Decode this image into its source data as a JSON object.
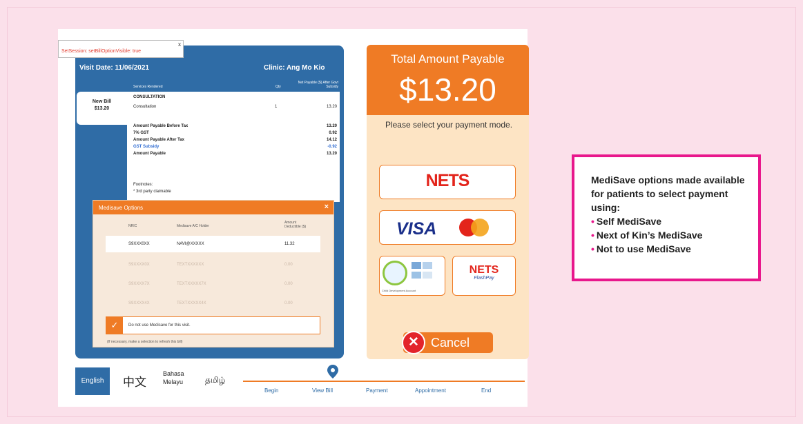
{
  "tooltip": {
    "text": "SetSession: setBillOptionVisible: true",
    "close": "x"
  },
  "bill": {
    "visit_date": "Visit Date: 11/06/2021",
    "clinic": "Clinic: Ang Mo Kio",
    "hdr_services": "Services Rendered",
    "hdr_qty": "Qty",
    "hdr_net": "Net Payable ($) After Govt Subsidy",
    "new_bill_label": "New Bill",
    "new_bill_amount": "$13.20",
    "lines": [
      {
        "label": "CONSULTATION",
        "qty": "",
        "amount": ""
      },
      {
        "label": "Consultation",
        "qty": "1",
        "amount": "13.20"
      },
      {
        "label": "Amount Payable Before Tax",
        "qty": "",
        "amount": "13.20"
      },
      {
        "label": "7% GST",
        "qty": "",
        "amount": "0.92"
      },
      {
        "label": "Amount Payable After Tax",
        "qty": "",
        "amount": "14.12"
      },
      {
        "label": "GST Subsidy",
        "qty": "",
        "amount": "-0.92"
      },
      {
        "label": "Amount Payable",
        "qty": "",
        "amount": "13.20"
      },
      {
        "label": "Footnotes:",
        "qty": "",
        "amount": ""
      },
      {
        "label": "* 3rd party claimable",
        "qty": "",
        "amount": ""
      }
    ]
  },
  "medisave": {
    "title": "Medisave Options",
    "close": "×",
    "col_nric": "NRIC",
    "col_holder": "Medisave A/C Holder",
    "col_deduct": "Amount Deductible ($)",
    "rows": [
      {
        "nric": "S9XXX0XX",
        "holder": "NAVI@XXXXX",
        "amount": "11.32",
        "selected": true
      },
      {
        "nric": "S9XXXX0X",
        "holder": "TEXTXXXXXX",
        "amount": "0.00",
        "selected": false
      },
      {
        "nric": "S9XXXX7X",
        "holder": "TEXTXXXXX7X",
        "amount": "0.00",
        "selected": false
      },
      {
        "nric": "S9XXXX4X",
        "holder": "TEXTXXXXX4X",
        "amount": "0.00",
        "selected": false
      }
    ],
    "opt_out": "Do not use Medisave for this visit.",
    "note": "(If necessary, make a selection to refresh this bill)"
  },
  "payment": {
    "total_label": "Total Amount Payable",
    "total_amount": "$13.20",
    "message": "Please select your payment mode.",
    "nets": "NETS",
    "visa": "VISA",
    "mastercard": "MasterCard",
    "cda": "Child Development Account",
    "nets_flashpay_1": "NETS",
    "nets_flashpay_2": "FlashPay",
    "cancel": "Cancel"
  },
  "languages": {
    "english": "English",
    "chinese": "中文",
    "malay_1": "Bahasa",
    "malay_2": "Melayu",
    "tamil": "தமிழ்"
  },
  "steps": [
    "Begin",
    "View Bill",
    "Payment",
    "Appointment",
    "End"
  ],
  "callout": {
    "title": "MediSave options made available for patients to select payment using:",
    "items": [
      "Self MediSave",
      "Next of Kin’s MediSave",
      "Not to use MediSave"
    ]
  },
  "colors": {
    "orange": "#ef7b25",
    "blue": "#2f6ca6",
    "pink": "#e8178c",
    "peach": "#fde4c4"
  }
}
